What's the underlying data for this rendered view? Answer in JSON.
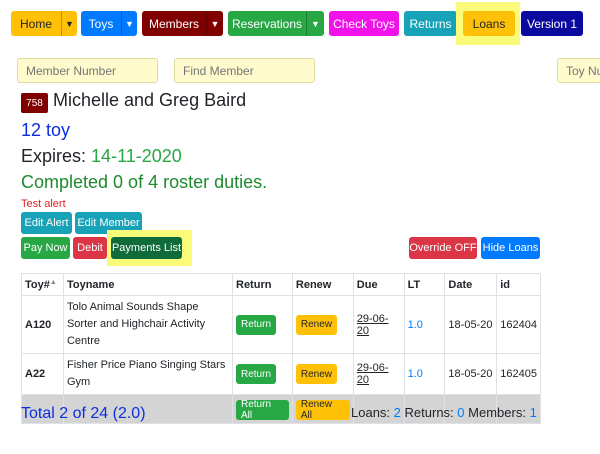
{
  "nav": {
    "home": "Home",
    "toys": "Toys",
    "members": "Members",
    "reservations": "Reservations",
    "check_toys": "Check Toys",
    "returns": "Returns",
    "loans": "Loans",
    "version": "Version 1"
  },
  "search": {
    "member_number_placeholder": "Member Number",
    "find_member_placeholder": "Find Member",
    "toy_number_placeholder": "Toy Nu"
  },
  "member": {
    "id_badge": "758",
    "name": "Michelle and Greg Baird",
    "toy_count": "12 toy",
    "expires_label": "Expires:",
    "expires_date": "14-11-2020",
    "roster": "Completed 0 of 4 roster duties.",
    "alert": "Test alert"
  },
  "actions": {
    "edit_alert": "Edit Alert",
    "edit_member": "Edit Member",
    "pay_now": "Pay Now",
    "debit": "Debit",
    "payments_list": "Payments List",
    "override": "Override OFF",
    "hide_loans": "Hide Loans"
  },
  "table": {
    "headers": {
      "toy": "Toy#",
      "sort_icon": "▲",
      "toyname": "Toyname",
      "return": "Return",
      "renew": "Renew",
      "due": "Due",
      "lt": "LT",
      "date": "Date",
      "id": "id"
    },
    "rows": [
      {
        "toy": "A120",
        "toyname": "Tolo Animal Sounds Shape Sorter and Highchair Activity Centre",
        "return": "Return",
        "renew": "Renew",
        "due": "29-06-20",
        "lt": "1.0",
        "date": "18-05-20",
        "id": "162404"
      },
      {
        "toy": "A22",
        "toyname": "Fisher Price Piano Singing Stars Gym",
        "return": "Return",
        "renew": "Renew",
        "due": "29-06-20",
        "lt": "1.0",
        "date": "18-05-20",
        "id": "162405"
      }
    ],
    "return_all": "Return All",
    "renew_all": "Renew All"
  },
  "summary": {
    "total": "Total 2 of 24 (2.0)",
    "loans_label": "Loans:",
    "loans_value": "2",
    "returns_label": "Returns:",
    "returns_value": "0",
    "members_label": "Members:",
    "members_value": "1"
  },
  "colors": {
    "orange": "#ffc107",
    "blue": "#007bff",
    "maroon": "#800000",
    "green": "#28a745",
    "magenta": "#f012e8",
    "teal": "#17a2b8",
    "navy": "#0a0a9e",
    "red": "#dc3545",
    "highlight": "#fbfb7a"
  }
}
